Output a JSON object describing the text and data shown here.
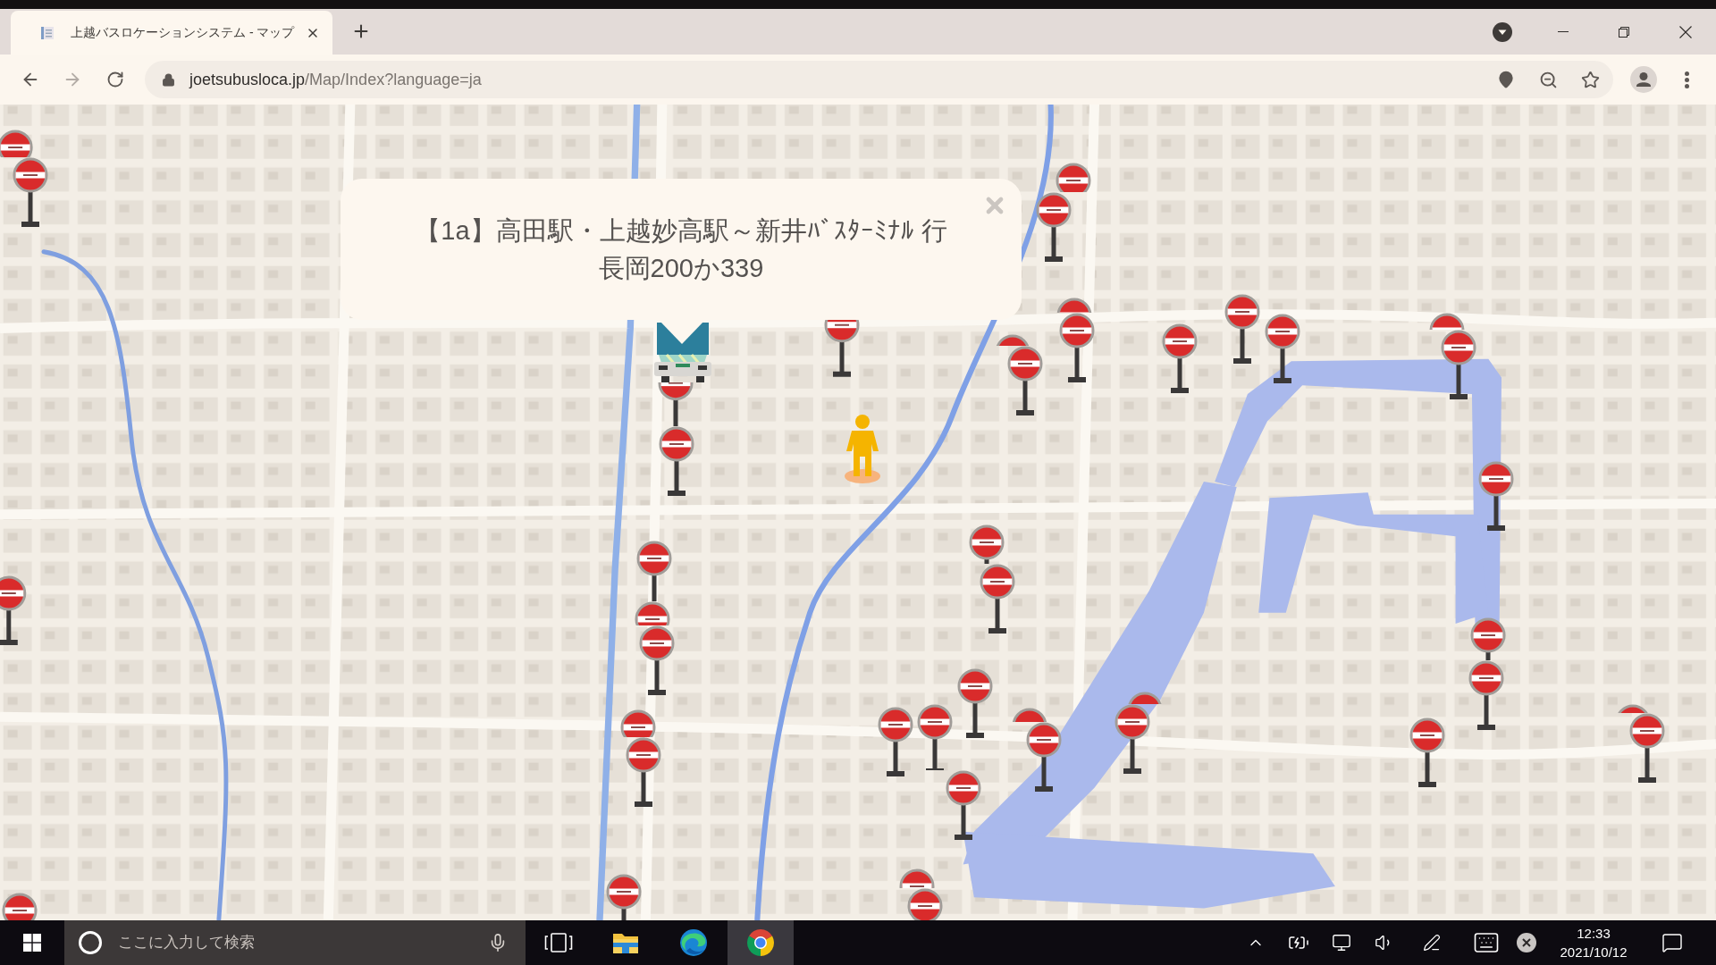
{
  "browser": {
    "tabs": [
      {
        "title": "上越バスロケーションシステム - マップ",
        "selected": true
      }
    ],
    "address_bar": {
      "host": "joetsubusloca.jp",
      "path": "/Map/Index?language=ja"
    }
  },
  "map": {
    "popup": {
      "route": "【1a】高田駅・上越妙高駅～新井ﾊﾞｽﾀｰﾐﾅﾙ 行",
      "vehicle": "長岡200か339"
    }
  },
  "taskbar": {
    "search": {
      "placeholder": "ここに入力して検索"
    },
    "apps": [
      {
        "kind": "explorer",
        "selected": false
      },
      {
        "kind": "edge",
        "selected": false
      },
      {
        "kind": "chrome",
        "selected": true
      }
    ],
    "clock": {
      "time": "12:33",
      "date": "2021/10/12"
    }
  }
}
